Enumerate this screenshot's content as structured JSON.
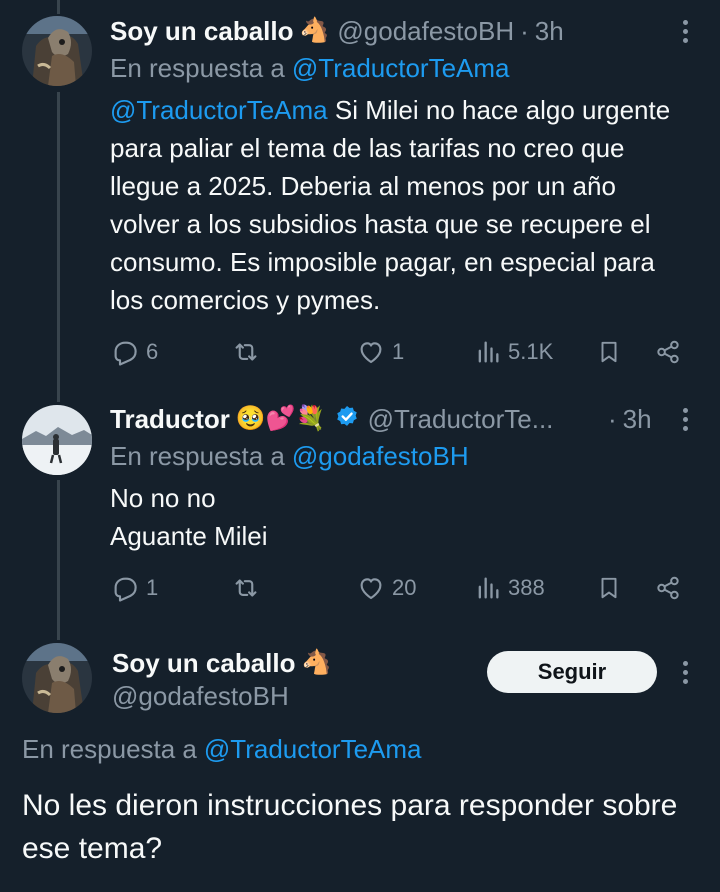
{
  "colors": {
    "background": "#15202b",
    "text_primary": "#f7f9f9",
    "text_secondary": "#8b98a5",
    "link": "#1d9bf0",
    "verified": "#1d9bf0",
    "button_bg": "#eff3f4"
  },
  "tweets": [
    {
      "display_name": "Soy un caballo",
      "emoji": "🐴",
      "handle": "@godafestoBH",
      "separator": "·",
      "time": "3h",
      "reply_prefix": "En respuesta a",
      "reply_to": "@TraductorTeAma",
      "mention": "@TraductorTeAma",
      "text": "Si Milei no hace algo urgente para paliar el tema de las tarifas no creo que llegue a 2025. Deberia al menos por un año volver a los subsidios hasta que se recupere el consumo. Es imposible pagar, en especial para los comercios y pymes.",
      "replies": "6",
      "retweets": "",
      "likes": "1",
      "views": "5.1K"
    },
    {
      "display_name": "Traductor",
      "emoji": "🥹💕💐",
      "verified": true,
      "handle": "@TraductorTe...",
      "separator": "·",
      "time": "3h",
      "reply_prefix": "En respuesta a",
      "reply_to": "@godafestoBH",
      "text_line1": "No no no",
      "text_line2": "Aguante Milei",
      "replies": "1",
      "retweets": "",
      "likes": "20",
      "views": "388"
    }
  ],
  "main_tweet": {
    "display_name": "Soy un caballo",
    "emoji": "🐴",
    "handle": "@godafestoBH",
    "follow_label": "Seguir",
    "reply_prefix": "En respuesta a",
    "reply_to": "@TraductorTeAma",
    "text": "No les dieron instrucciones para responder sobre ese tema?"
  },
  "icons": [
    "reply-icon",
    "retweet-icon",
    "like-icon",
    "views-icon",
    "bookmark-icon",
    "share-icon",
    "more-icon",
    "verified-icon"
  ]
}
